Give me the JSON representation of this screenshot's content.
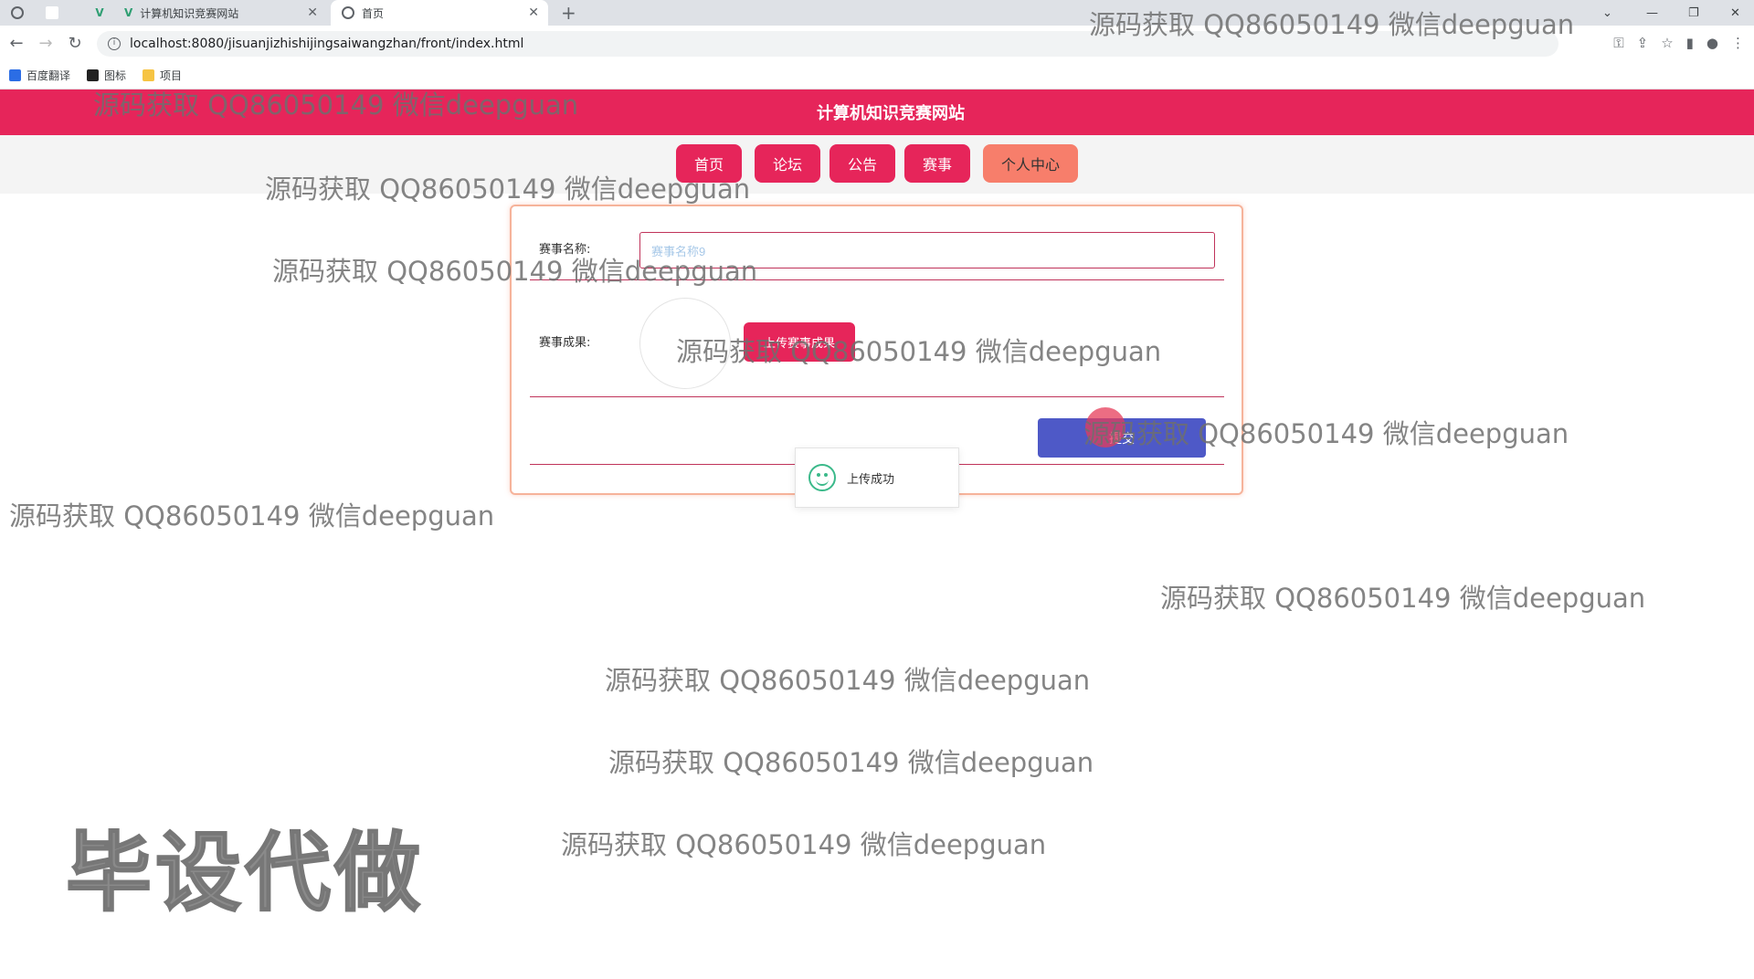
{
  "browser": {
    "tabs": [
      {
        "label": "计算机知识竞赛网站"
      },
      {
        "label": "首页"
      }
    ],
    "url": "localhost:8080/jisuanjizhishijingsaiwangzhan/front/index.html",
    "bookmarks": [
      "百度翻译",
      "图标",
      "项目"
    ]
  },
  "site": {
    "title": "计算机知识竞赛网站",
    "nav": [
      "首页",
      "论坛",
      "公告",
      "赛事",
      "个人中心"
    ]
  },
  "form": {
    "name_label": "赛事名称:",
    "name_value": "赛事名称9",
    "result_label": "赛事成果:",
    "upload_label": "上传赛事成果",
    "submit_label": "提交"
  },
  "toast": {
    "message": "上传成功"
  },
  "watermark": {
    "text": "源码获取 QQ86050149 微信deepguan",
    "big": "毕设代做"
  },
  "colors": {
    "primary": "#e6255a",
    "submit": "#4e59c7",
    "accent": "#f77e6b"
  }
}
